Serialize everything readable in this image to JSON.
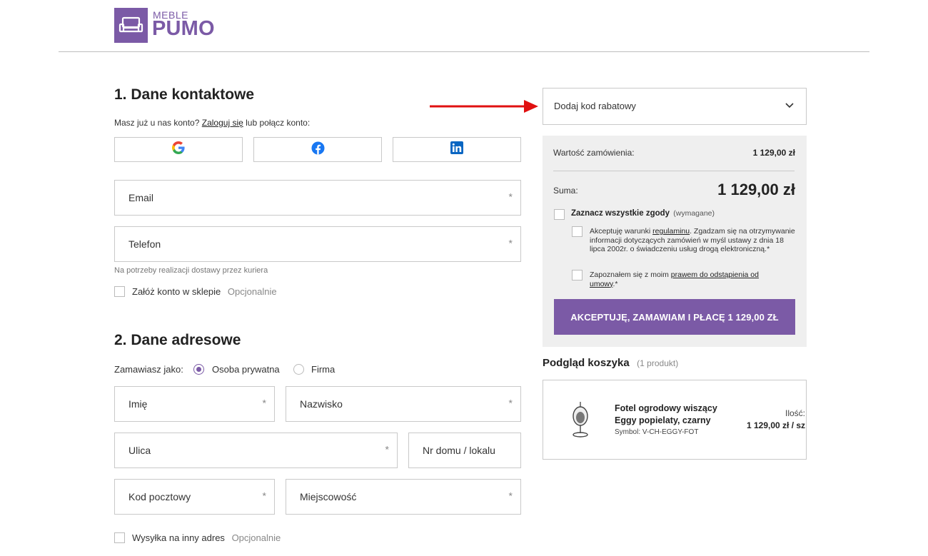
{
  "brand": {
    "top": "MEBLE",
    "main": "PUMO",
    "color": "#7b5aa6"
  },
  "contact": {
    "title": "1. Dane kontaktowe",
    "account_prefix": "Masz już u nas konto?",
    "login_link": "Zaloguj się",
    "account_suffix": "lub połącz konto:",
    "social": [
      "google-icon",
      "facebook-icon",
      "linkedin-icon"
    ],
    "email_label": "Email",
    "phone_label": "Telefon",
    "required_mark": "*",
    "phone_hint": "Na potrzeby realizacji dostawy przez kuriera",
    "create_account_label": "Załóż konto w sklepie",
    "optional_label": "Opcjonalnie"
  },
  "address": {
    "title": "2. Dane adresowe",
    "order_as_label": "Zamawiasz jako:",
    "options": [
      "Osoba prywatna",
      "Firma"
    ],
    "selected_option": "Osoba prywatna",
    "first_name": "Imię",
    "last_name": "Nazwisko",
    "street": "Ulica",
    "house_no": "Nr domu / lokalu",
    "postal_code": "Kod pocztowy",
    "city": "Miejscowość",
    "ship_other_label": "Wysyłka na inny adres",
    "optional_label": "Opcjonalnie"
  },
  "discount": {
    "label": "Dodaj kod rabatowy"
  },
  "summary": {
    "order_value_label": "Wartość zamówienia:",
    "order_value": "1 129,00 zł",
    "total_label": "Suma:",
    "total": "1 129,00 zł",
    "all_consents_label": "Zaznacz wszystkie zgody",
    "all_consents_note": "(wymagane)",
    "consent1_prefix": "Akceptuję warunki",
    "consent1_link": "regulaminu",
    "consent1_suffix": ". Zgadzam się na otrzymywanie informacji dotyczących zamówień w myśl ustawy z dnia 18 lipca 2002r. o świadczeniu usług drogą elektroniczną.*",
    "consent2_prefix": "Zapoznałem się z moim",
    "consent2_link": "prawem do odstąpienia od umowy",
    "consent2_suffix": ".*",
    "cta_label": "AKCEPTUJĘ, ZAMAWIAM I PŁACĘ 1 129,00 ZŁ"
  },
  "cart": {
    "title": "Podgląd koszyka",
    "count": "(1 produkt)",
    "product_name_line1": "Fotel ogrodowy wiszący",
    "product_name_line2": "Eggy popielaty, czarny",
    "symbol": "Symbol: V-CH-EGGY-FOT",
    "qty_label": "Ilość:",
    "price": "1 129,00 zł / sz"
  },
  "colors": {
    "accent": "#7b5aa6",
    "arrow": "#e01010"
  }
}
